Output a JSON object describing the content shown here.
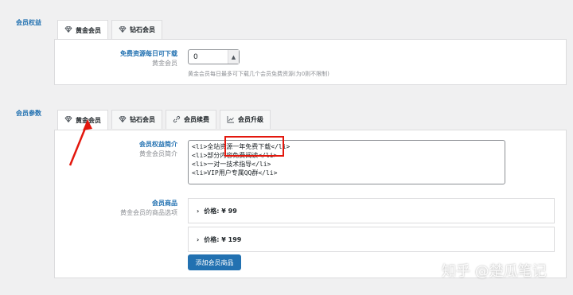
{
  "sections": {
    "member_benefits": {
      "label": "会员权益",
      "tabs": [
        {
          "label": "黄金会员",
          "icon": "diamond-icon",
          "active": true
        },
        {
          "label": "钻石会员",
          "icon": "diamond-icon",
          "active": false
        }
      ],
      "field": {
        "title": "免费资源每日可下载",
        "sub": "黄金会员",
        "value": "0",
        "spin_icon": "chevron-up-icon",
        "hint": "黄金会员每日最多可下载几个会员免费资源(为0则不限制)"
      }
    },
    "member_params": {
      "label": "会员参数",
      "tabs": [
        {
          "label": "黄金会员",
          "icon": "diamond-icon",
          "active": true
        },
        {
          "label": "钻石会员",
          "icon": "diamond-icon",
          "active": false
        },
        {
          "label": "会员续费",
          "icon": "link-icon",
          "active": false
        },
        {
          "label": "会员升级",
          "icon": "trend-up-icon",
          "active": false
        }
      ],
      "intro": {
        "title": "会员权益简介",
        "sub": "黄金会员简介",
        "lines": [
          "<li>全站资源一年免费下载</li>",
          "<li>部分内容免费阅读</li>",
          "<li>一对一技术指导</li>",
          "<li>VIP用户专属QQ群</li>"
        ]
      },
      "products": {
        "title": "会员商品",
        "sub": "黄金会员的商品选项",
        "items": [
          {
            "label": "价格: ¥ 99"
          },
          {
            "label": "价格: ¥ 199"
          }
        ],
        "add_button": "添加会员商品"
      }
    }
  },
  "annotation": {
    "highlight_color": "#e3170d"
  },
  "watermark": "知乎 @楚瓜笔记",
  "colors": {
    "accent": "#2271b1",
    "background": "#f0f0f1"
  }
}
